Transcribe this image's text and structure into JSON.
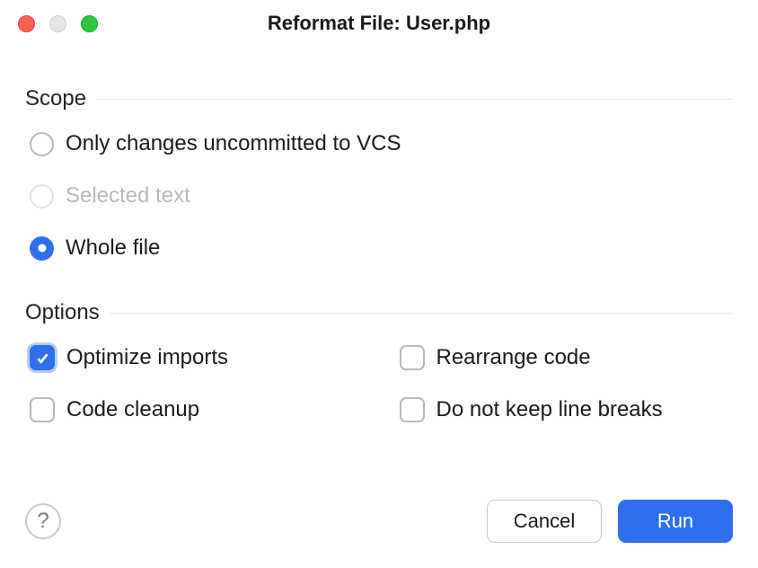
{
  "title": "Reformat File: User.php",
  "sections": {
    "scope": {
      "label": "Scope",
      "options": {
        "uncommitted": "Only changes uncommitted to VCS",
        "selected_text": "Selected text",
        "whole_file": "Whole file"
      },
      "selected": "whole_file",
      "disabled": [
        "selected_text"
      ]
    },
    "options": {
      "label": "Options",
      "items": {
        "optimize_imports": {
          "label": "Optimize imports",
          "checked": true
        },
        "rearrange_code": {
          "label": "Rearrange code",
          "checked": false
        },
        "code_cleanup": {
          "label": "Code cleanup",
          "checked": false
        },
        "no_line_breaks": {
          "label": "Do not keep line breaks",
          "checked": false
        }
      }
    }
  },
  "buttons": {
    "help": "?",
    "cancel": "Cancel",
    "run": "Run"
  }
}
